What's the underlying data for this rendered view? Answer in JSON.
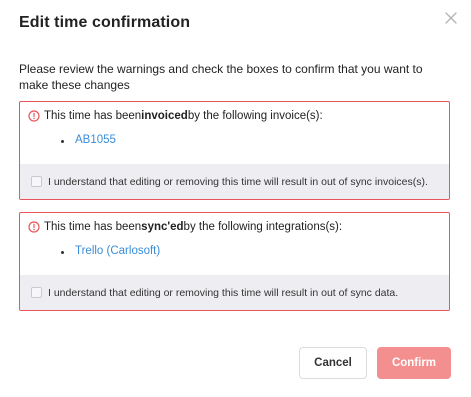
{
  "dialog": {
    "title": "Edit time confirmation",
    "intro": "Please review the warnings and check the boxes to confirm that you want to make these changes"
  },
  "warnings": [
    {
      "prefix": "This time has been ",
      "keyword": "invoiced",
      "suffix": " by the following invoice(s):",
      "items": [
        "AB1055"
      ],
      "confirm_text": "I understand that editing or removing this time will result in out of sync invoices(s).",
      "checked": false
    },
    {
      "prefix": "This time has been ",
      "keyword": "sync'ed",
      "suffix": " by the following integrations(s):",
      "items": [
        "Trello (Carlosoft)"
      ],
      "confirm_text": "I understand that editing or removing this time will result in out of sync data.",
      "checked": false
    }
  ],
  "buttons": {
    "cancel": "Cancel",
    "confirm": "Confirm"
  },
  "colors": {
    "warning_border": "#e8565b",
    "link": "#3a8dd8",
    "confirm_button": "#f48f8f",
    "confirm_row_bg": "#eeeef2"
  },
  "icons": {
    "close": "close-icon",
    "warning": "exclamation-circle-icon"
  }
}
